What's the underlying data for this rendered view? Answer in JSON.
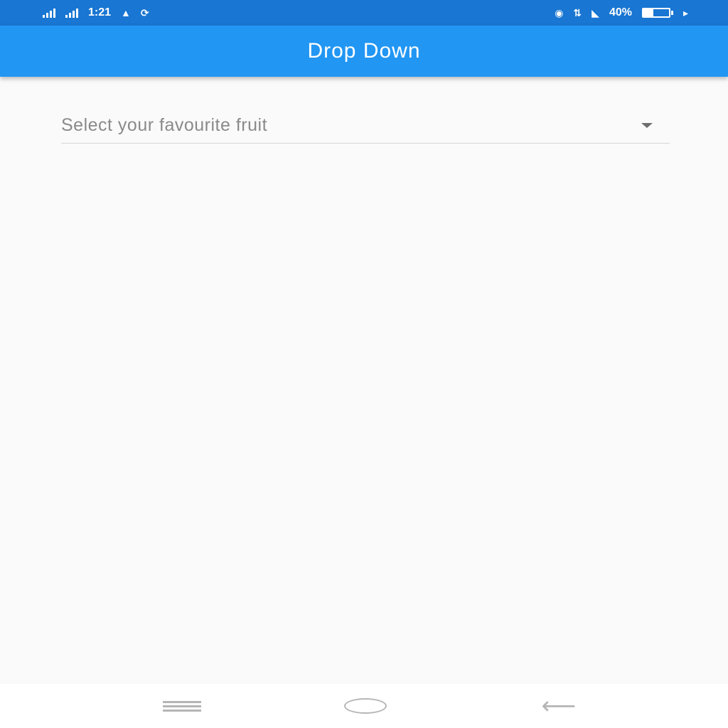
{
  "status_bar": {
    "left_text": "1:21",
    "right_text": "40%",
    "network_icons": [
      "signal-icon",
      "signal-icon"
    ],
    "battery_level": 0.4
  },
  "app_bar": {
    "title": "Drop Down",
    "color": "#2196f3"
  },
  "dropdown": {
    "hint": "Select your favourite fruit"
  },
  "nav_bar": {
    "buttons": [
      "menu-icon",
      "home-icon",
      "back-icon"
    ]
  }
}
